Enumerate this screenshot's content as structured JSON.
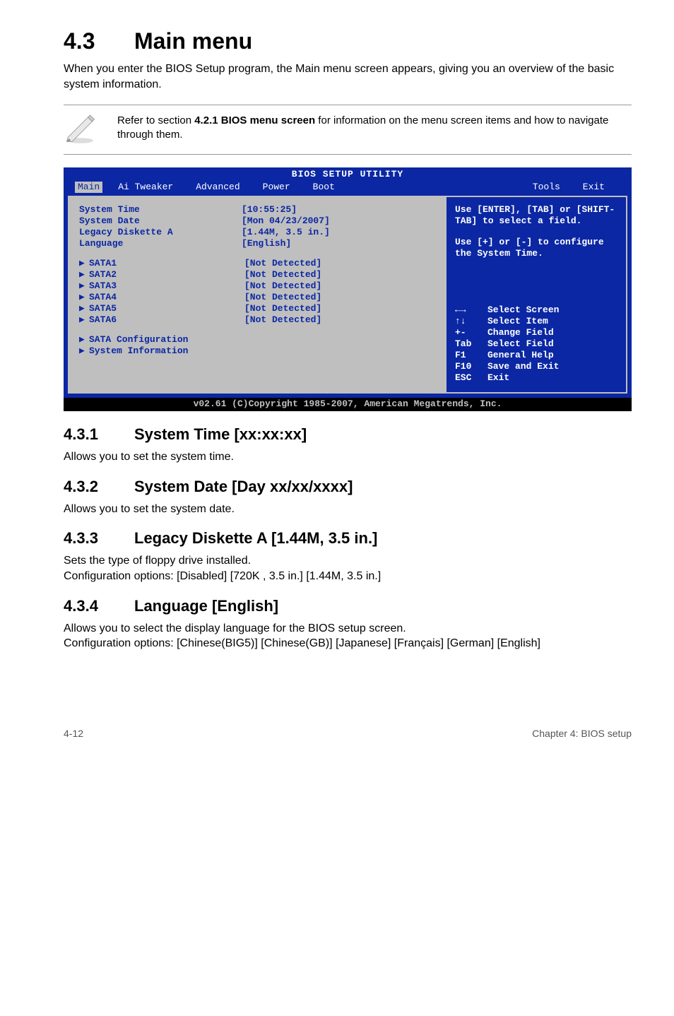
{
  "section": {
    "num": "4.3",
    "title": "Main menu"
  },
  "intro": "When you enter the BIOS Setup program, the Main menu screen appears, giving you an overview of the basic system information.",
  "note": {
    "text_before": "Refer to section ",
    "bold": "4.2.1  BIOS menu screen",
    "text_after": " for information on the menu screen items and how to navigate through them."
  },
  "bios": {
    "title": "BIOS SETUP UTILITY",
    "tabs": [
      "Main",
      "Ai Tweaker",
      "Advanced",
      "Power",
      "Boot",
      "Tools",
      "Exit"
    ],
    "sel_tab": "Main",
    "left_rows": [
      {
        "lab": "System Time",
        "val": "[10:55:25]"
      },
      {
        "lab": "System Date",
        "val": "[Mon 04/23/2007]"
      },
      {
        "lab": "Legacy Diskette A",
        "val": "[1.44M, 3.5 in.]"
      },
      {
        "lab": "Language",
        "val": "[English]"
      }
    ],
    "sata_rows": [
      {
        "lab": "SATA1",
        "val": "[Not Detected]"
      },
      {
        "lab": "SATA2",
        "val": "[Not Detected]"
      },
      {
        "lab": "SATA3",
        "val": "[Not Detected]"
      },
      {
        "lab": "SATA4",
        "val": "[Not Detected]"
      },
      {
        "lab": "SATA5",
        "val": "[Not Detected]"
      },
      {
        "lab": "SATA6",
        "val": "[Not Detected]"
      }
    ],
    "extra_rows": [
      {
        "lab": "SATA Configuration"
      },
      {
        "lab": "System Information"
      }
    ],
    "help1": "Use [ENTER], [TAB] or [SHIFT-TAB] to select a field.",
    "help2": "Use [+] or [-] to configure the System Time.",
    "legend": [
      {
        "k": "←→",
        "v": "Select Screen"
      },
      {
        "k": "↑↓",
        "v": "Select Item"
      },
      {
        "k": "+-",
        "v": "Change Field"
      },
      {
        "k": "Tab",
        "v": "Select Field"
      },
      {
        "k": "F1",
        "v": "General Help"
      },
      {
        "k": "F10",
        "v": "Save and Exit"
      },
      {
        "k": "ESC",
        "v": "Exit"
      }
    ],
    "copyright": "v02.61 (C)Copyright 1985-2007, American Megatrends, Inc."
  },
  "subs": {
    "s431": {
      "n": "4.3.1",
      "t": "System Time [xx:xx:xx]",
      "p": "Allows you to set the system time."
    },
    "s432": {
      "n": "4.3.2",
      "t": "System Date [Day xx/xx/xxxx]",
      "p": "Allows you to set the system date."
    },
    "s433": {
      "n": "4.3.3",
      "t": "Legacy Diskette A [1.44M, 3.5 in.]",
      "p1": "Sets the type of floppy drive installed.",
      "p2": "Configuration options: [Disabled] [720K , 3.5 in.] [1.44M, 3.5 in.]"
    },
    "s434": {
      "n": "4.3.4",
      "t": "Language [English]",
      "p1": "Allows you to select the display language for the BIOS setup screen.",
      "p2": "Configuration options: [Chinese(BIG5)] [Chinese(GB)] [Japanese] [Français] [German] [English]"
    }
  },
  "footer": {
    "left": "4-12",
    "right": "Chapter 4: BIOS setup"
  }
}
